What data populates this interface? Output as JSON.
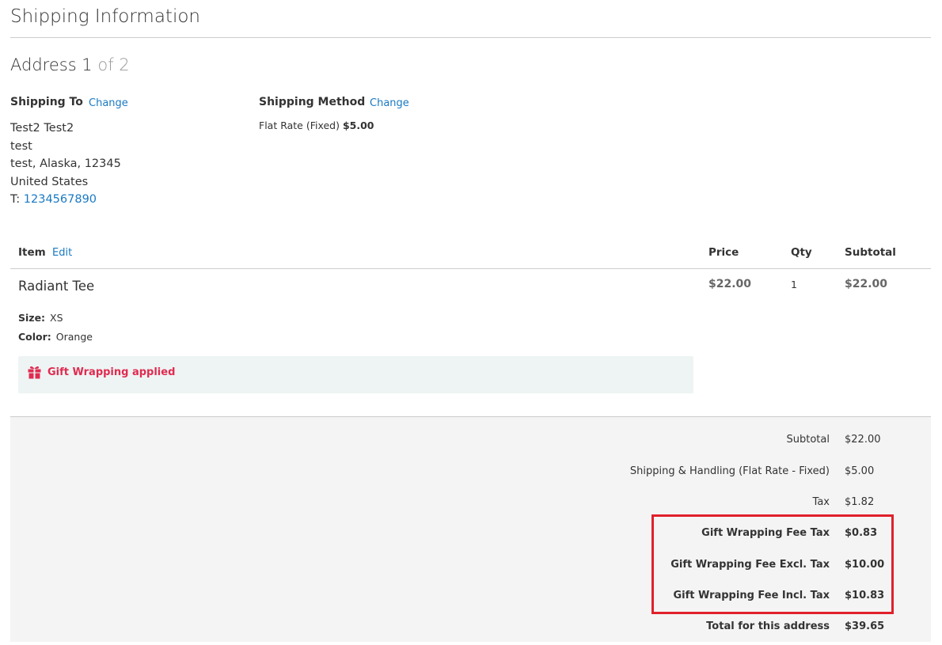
{
  "page": {
    "title": "Shipping Information"
  },
  "address": {
    "heading": "Address 1",
    "of_text": "of 2"
  },
  "shipping_to": {
    "title": "Shipping To",
    "change_label": "Change",
    "lines": [
      "Test2 Test2",
      "test",
      "test, Alaska, 12345",
      "United States"
    ],
    "phone_prefix": "T: ",
    "phone": "1234567890"
  },
  "shipping_method": {
    "title": "Shipping Method",
    "change_label": "Change",
    "method": "Flat Rate (Fixed)",
    "price": "$5.00"
  },
  "items_table": {
    "headers": {
      "item": "Item",
      "edit": "Edit",
      "price": "Price",
      "qty": "Qty",
      "subtotal": "Subtotal"
    },
    "rows": [
      {
        "name": "Radiant Tee",
        "price": "$22.00",
        "qty": "1",
        "subtotal": "$22.00",
        "options": [
          {
            "label": "Size:",
            "value": "XS"
          },
          {
            "label": "Color:",
            "value": "Orange"
          }
        ],
        "gift_wrapping": {
          "icon": "gift-icon",
          "text": "Gift Wrapping applied"
        }
      }
    ]
  },
  "totals": [
    {
      "label": "Subtotal",
      "value": "$22.00",
      "bold": false
    },
    {
      "label": "Shipping & Handling (Flat Rate - Fixed)",
      "value": "$5.00",
      "bold": false
    },
    {
      "label": "Tax",
      "value": "$1.82",
      "bold": false
    },
    {
      "label": "Gift Wrapping Fee Tax",
      "value": "$0.83",
      "bold": true
    },
    {
      "label": "Gift Wrapping Fee Excl. Tax",
      "value": "$10.00",
      "bold": true
    },
    {
      "label": "Gift Wrapping Fee Incl. Tax",
      "value": "$10.83",
      "bold": true
    },
    {
      "label": "Total for this address",
      "value": "$39.65",
      "bold": true
    }
  ],
  "colors": {
    "link": "#1979c3",
    "gift_accent": "#e02b50",
    "highlight_border": "#e0202a",
    "totals_background": "#f4f4f4",
    "gift_box_background": "#eef4f4"
  }
}
